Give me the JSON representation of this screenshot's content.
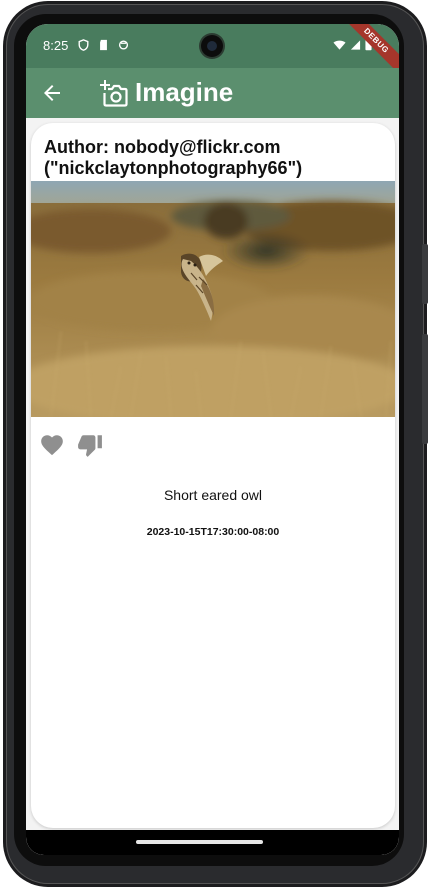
{
  "status_bar": {
    "time": "8:25",
    "debug_label": "DEBUG"
  },
  "app_bar": {
    "title": "Imagine",
    "icons": [
      "back-arrow-icon",
      "add-a-photo-icon"
    ]
  },
  "card": {
    "author_line1": "Author: nobody@flickr.com",
    "author_line2": "(\"nickclaytonphotography66\")",
    "caption": "Short eared owl",
    "timestamp": "2023-10-15T17:30:00-08:00",
    "actions": [
      "heart-icon",
      "thumb-down-icon"
    ]
  },
  "colors": {
    "status_bar": "#497c5e",
    "app_bar": "#5b8f6e",
    "action_icon": "#8f8f8f",
    "debug_banner": "#a5362b"
  }
}
